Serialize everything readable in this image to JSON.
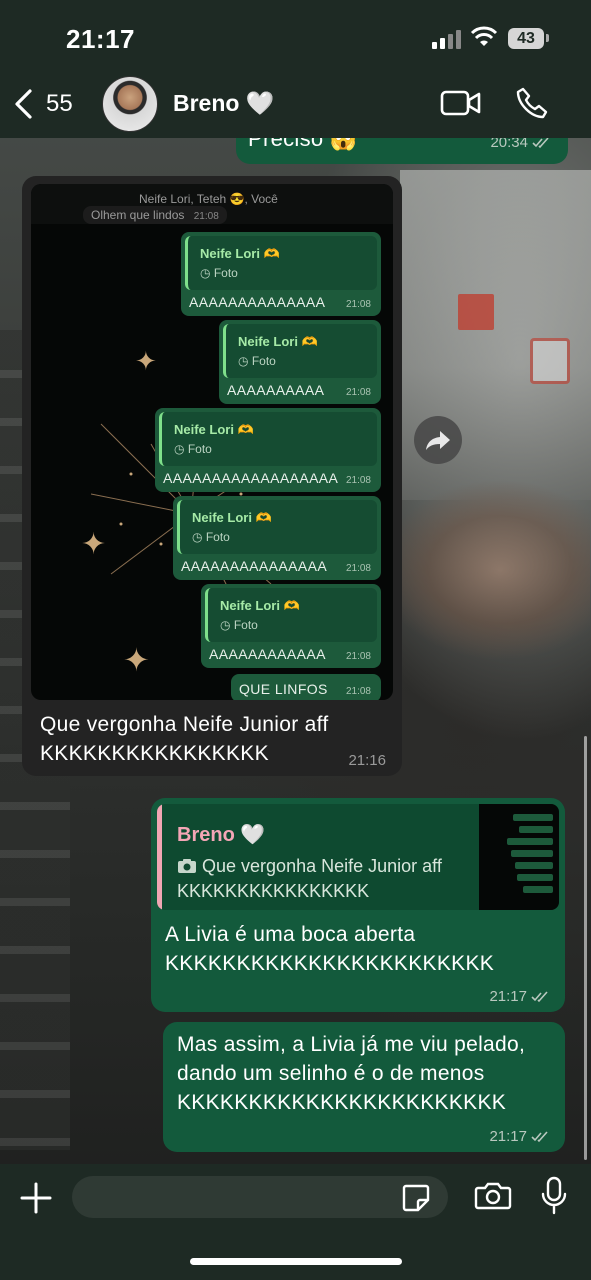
{
  "status_bar": {
    "time": "21:17",
    "battery": "43"
  },
  "header": {
    "back_count": "55",
    "contact_name": "Breno 🤍"
  },
  "messages": {
    "top_cut": {
      "text": "Preciso 😱",
      "time": "20:34"
    },
    "image_message": {
      "screenshot": {
        "group_members": "Neife Lori, Teteh 😎, Você",
        "preview_text": "Olhem que lindos",
        "preview_time": "21:08",
        "bubbles": [
          {
            "quote_name": "Neife Lori 🫶",
            "quote_sub": "Foto",
            "text": "AAAAAAAAAAAAAA",
            "time": "21:08"
          },
          {
            "quote_name": "Neife Lori 🫶",
            "quote_sub": "Foto",
            "text": "AAAAAAAAAA",
            "time": "21:08"
          },
          {
            "quote_name": "Neife Lori 🫶",
            "quote_sub": "Foto",
            "text": "AAAAAAAAAAAAAAAAAA",
            "time": "21:08"
          },
          {
            "quote_name": "Neife Lori 🫶",
            "quote_sub": "Foto",
            "text": "AAAAAAAAAAAAAAA",
            "time": "21:08"
          },
          {
            "quote_name": "Neife Lori 🫶",
            "quote_sub": "Foto",
            "text": "AAAAAAAAAAAA",
            "time": "21:08"
          }
        ],
        "last_text": "QUE LINFOS",
        "last_time": "21:08"
      },
      "caption": "Que vergonha Neife Junior aff KKKKKKKKKKKKKKKK",
      "time": "21:16"
    },
    "reply_message": {
      "quote_name": "Breno 🤍",
      "quote_text": "Que vergonha Neife Junior aff KKKKKKKKKKKKKKKK",
      "text": "A Livia é uma boca aberta KKKKKKKKKKKKKKKKKKKKKKK",
      "time": "21:17"
    },
    "last_message": {
      "text": "Mas assim, a Livia já me viu pelado, dando um selinho é o de menos KKKKKKKKKKKKKKKKKKKKKKK",
      "time": "21:17"
    }
  },
  "input": {
    "value": "",
    "placeholder": ""
  },
  "colors": {
    "outgoing_bubble": "#135a3c",
    "incoming_bubble": "#232323",
    "bar_background": "#1e2a24",
    "reply_accent": "#f4a6b6"
  },
  "icons": [
    "back-chevron-icon",
    "video-call-icon",
    "phone-icon",
    "forward-icon",
    "plus-icon",
    "sticker-icon",
    "camera-icon",
    "mic-icon",
    "double-check-icon",
    "camera-small-icon"
  ]
}
